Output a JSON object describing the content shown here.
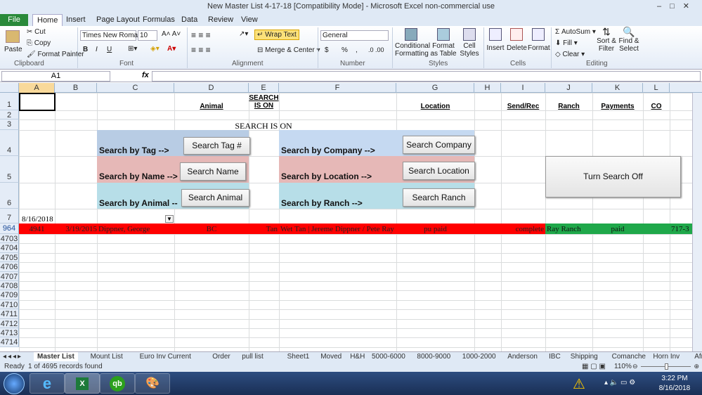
{
  "window": {
    "title": "New Master List 4-17-18  [Compatibility Mode]  -  Microsoft Excel non-commercial use"
  },
  "ribbon_tabs": [
    "File",
    "Home",
    "Insert",
    "Page Layout",
    "Formulas",
    "Data",
    "Review",
    "View"
  ],
  "ribbon": {
    "clipboard": {
      "paste": "Paste",
      "cut": "Cut",
      "copy": "Copy",
      "format_painter": "Format Painter",
      "group": "Clipboard"
    },
    "font": {
      "name": "Times New Roman",
      "size": "10",
      "group": "Font",
      "bold": "B",
      "italic": "I",
      "underline": "U"
    },
    "alignment": {
      "wrap": "Wrap Text",
      "merge": "Merge & Center",
      "group": "Alignment"
    },
    "number": {
      "format": "General",
      "currency": "$",
      "percent": "%",
      "comma": ",",
      "group": "Number"
    },
    "styles": {
      "conditional": "Conditional Formatting",
      "table": "Format as Table",
      "cell": "Cell Styles",
      "group": "Styles"
    },
    "cells": {
      "insert": "Insert",
      "delete": "Delete",
      "format": "Format",
      "group": "Cells"
    },
    "editing": {
      "autosum": "AutoSum",
      "fill": "Fill",
      "clear": "Clear",
      "sort": "Sort & Filter",
      "find": "Find & Select",
      "group": "Editing"
    }
  },
  "formula_bar": {
    "name_box": "A1",
    "fx": "fx",
    "value": ""
  },
  "columns": [
    "A",
    "B",
    "C",
    "D",
    "E",
    "F",
    "G",
    "H",
    "I",
    "J",
    "K",
    "L"
  ],
  "headers": {
    "D": "Animal",
    "E": "SEARCH IS ON",
    "G": "Location",
    "I": "Send/Rec",
    "J": "Ranch",
    "K": "Payments",
    "L": "CO"
  },
  "search_status": "SEARCH IS ON",
  "search": {
    "tag_label": "Search by Tag -->",
    "tag_button": "Search Tag #",
    "name_label": "Search by Name -->",
    "name_button": "Search Name",
    "animal_label": "Search by Animal --",
    "animal_button": "Search Animal",
    "company_label": "Search by Company -->",
    "company_button": "Search Company",
    "location_label": "Search by Location -->",
    "location_button": "Search Location",
    "ranch_label": "Search by Ranch -->",
    "ranch_button": "Search Ranch",
    "off_button": "Turn Search Off"
  },
  "row7_date": "8/16/2018",
  "record": {
    "row": "964",
    "tag": "4941",
    "date": "3/19/2015",
    "name": "Dippner, George",
    "animal": "BC",
    "type": "Tan",
    "location_detail": "Wet Tan | Jereme Dippner / Pete Ray",
    "location": "pu paid",
    "send_rec": "complete",
    "ranch": "Ray Ranch",
    "payments": "paid",
    "co": "717-3"
  },
  "row_numbers": [
    "1",
    "2",
    "3",
    "4",
    "5",
    "6",
    "7",
    "964",
    "4703",
    "4704",
    "4705",
    "4706",
    "4707",
    "4708",
    "4709",
    "4710",
    "4711",
    "4712",
    "4713",
    "4714"
  ],
  "sheet_tabs": [
    "Master List",
    "Mount List",
    "Euro Inv Current",
    "Order",
    "pull list",
    "Sheet1",
    "Moved",
    "H&H",
    "5000-6000",
    "8000-9000",
    "1000-2000",
    "Anderson",
    "IBC",
    "Shipping",
    "Comanche",
    "Horn Inv",
    "African"
  ],
  "status": {
    "ready": "Ready",
    "records": "1 of 4695 records found",
    "zoom": "110%"
  },
  "taskbar": {
    "time": "3:22 PM",
    "date": "8/16/2018"
  },
  "colors": {
    "red": "#ff0000",
    "green": "#1fa84a",
    "blue_band": "#b8cce4",
    "pink_band": "#e6b8b7",
    "cyan_band": "#b7dee8"
  }
}
